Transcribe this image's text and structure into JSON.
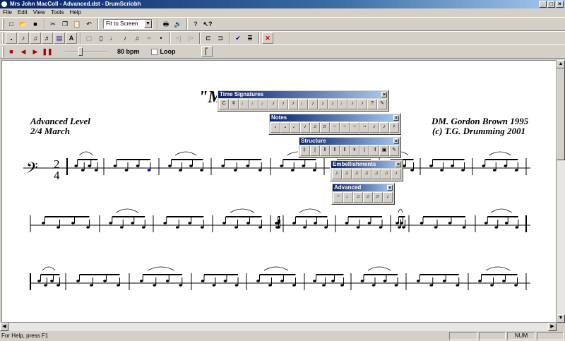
{
  "window": {
    "title": "Mrs John MacColl - Advanced.dst - DrumScriobh"
  },
  "menu": [
    "File",
    "Edit",
    "View",
    "Tools",
    "Help"
  ],
  "toolbar": {
    "zoom": "Fit to Screen"
  },
  "playback": {
    "tempo": "80 bpm",
    "loop_label": "Loop",
    "tempo_fraction": 0.35
  },
  "score": {
    "title": "\"M",
    "level": "Advanced Level",
    "tune_type": "2/4 March",
    "composer": "DM. Gordon Brown 1995",
    "copyright": "(c) T.G. Drumming 2001",
    "time_sig_top": "2",
    "time_sig_bottom": "4"
  },
  "palettes": {
    "time_signatures": {
      "title": "Time Signatures"
    },
    "notes": {
      "title": "Notes"
    },
    "structure": {
      "title": "Structure"
    },
    "embellishments": {
      "title": "Embellishments"
    },
    "advanced": {
      "title": "Advanced"
    }
  },
  "status": {
    "help": "For Help, press F1",
    "num": "NUM"
  },
  "colors": {
    "titlebar": "#0a246a",
    "selected_note": "#0000cc",
    "stop": "#aa0000"
  }
}
